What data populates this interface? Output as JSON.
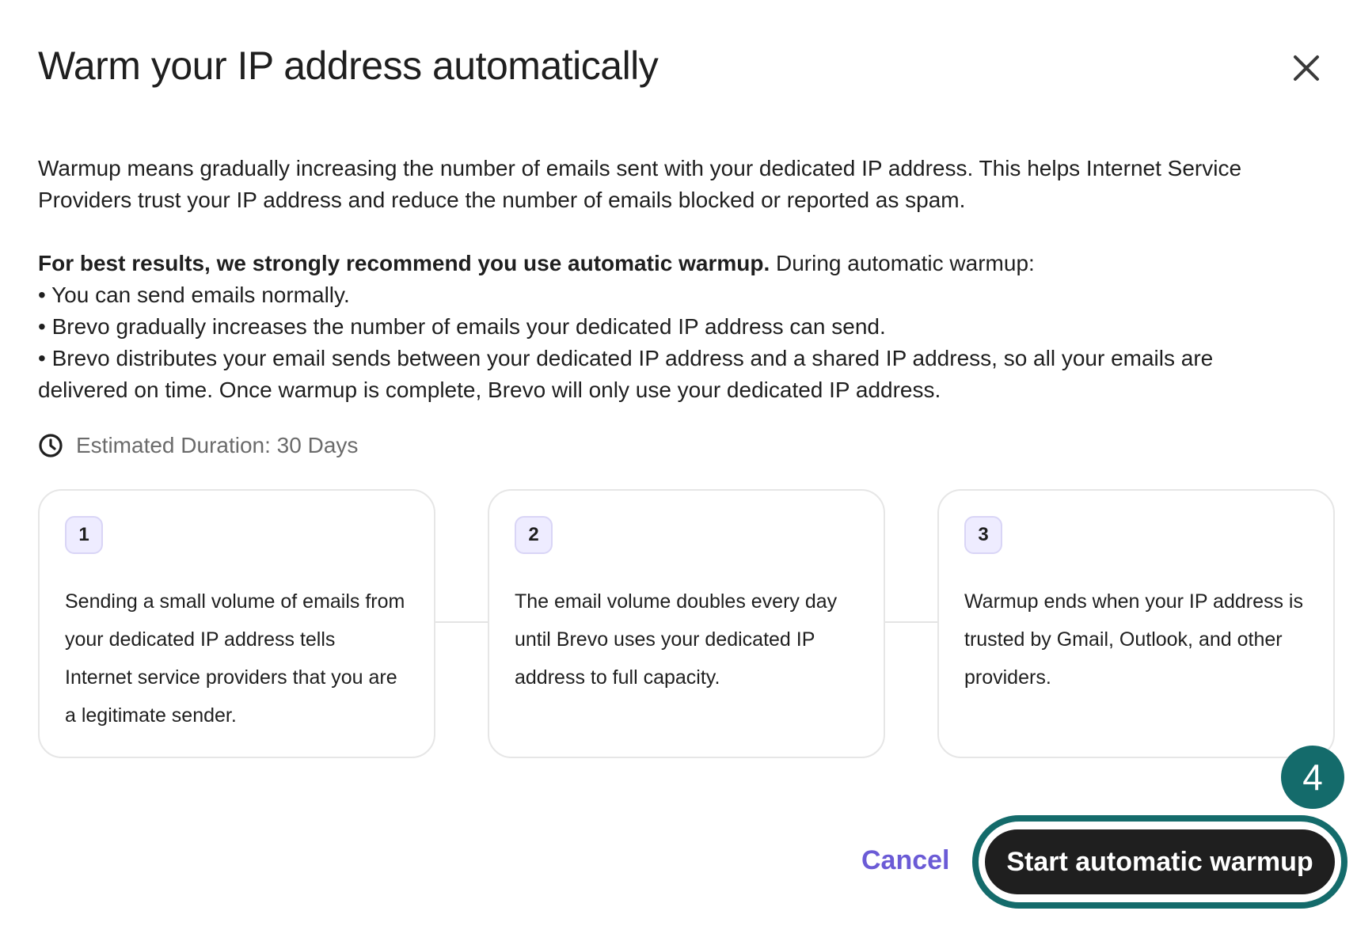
{
  "dialog": {
    "title": "Warm your IP address automatically",
    "close_icon": "close-icon"
  },
  "intro": {
    "line1": "Warmup means gradually increasing the number of emails sent with your dedicated IP address. This helps Internet Service",
    "line2": "Providers trust your IP address and reduce the number of emails blocked or reported as spam."
  },
  "recommendation": {
    "bold": "For best results, we strongly recommend you use automatic warmup.",
    "rest": " During automatic warmup:",
    "bullets": [
      "• You can send emails normally.",
      "• Brevo gradually increases the number of emails your dedicated IP address can send.",
      "• Brevo distributes your email sends between your dedicated IP address and a shared IP address, so all your emails are",
      "delivered on time. Once warmup is complete, Brevo will only use your dedicated IP address."
    ]
  },
  "duration": {
    "icon": "clock-icon",
    "text": "Estimated Duration: 30 Days"
  },
  "steps": [
    {
      "number": "1",
      "text": "Sending a small volume of emails from your dedicated IP address tells Internet service providers that you are a legitimate sender."
    },
    {
      "number": "2",
      "text": "The email volume doubles every day until Brevo uses your dedicated IP address to full capacity."
    },
    {
      "number": "3",
      "text": "Warmup ends when your IP address is trusted by Gmail, Outlook, and other providers."
    }
  ],
  "annotation": {
    "step_marker": "4",
    "color": "#146b6b"
  },
  "footer": {
    "cancel_label": "Cancel",
    "primary_label": "Start automatic warmup"
  },
  "colors": {
    "accent": "#6b5bd6",
    "primary_bg": "#1f1f1f",
    "badge_bg": "#eeecff"
  }
}
